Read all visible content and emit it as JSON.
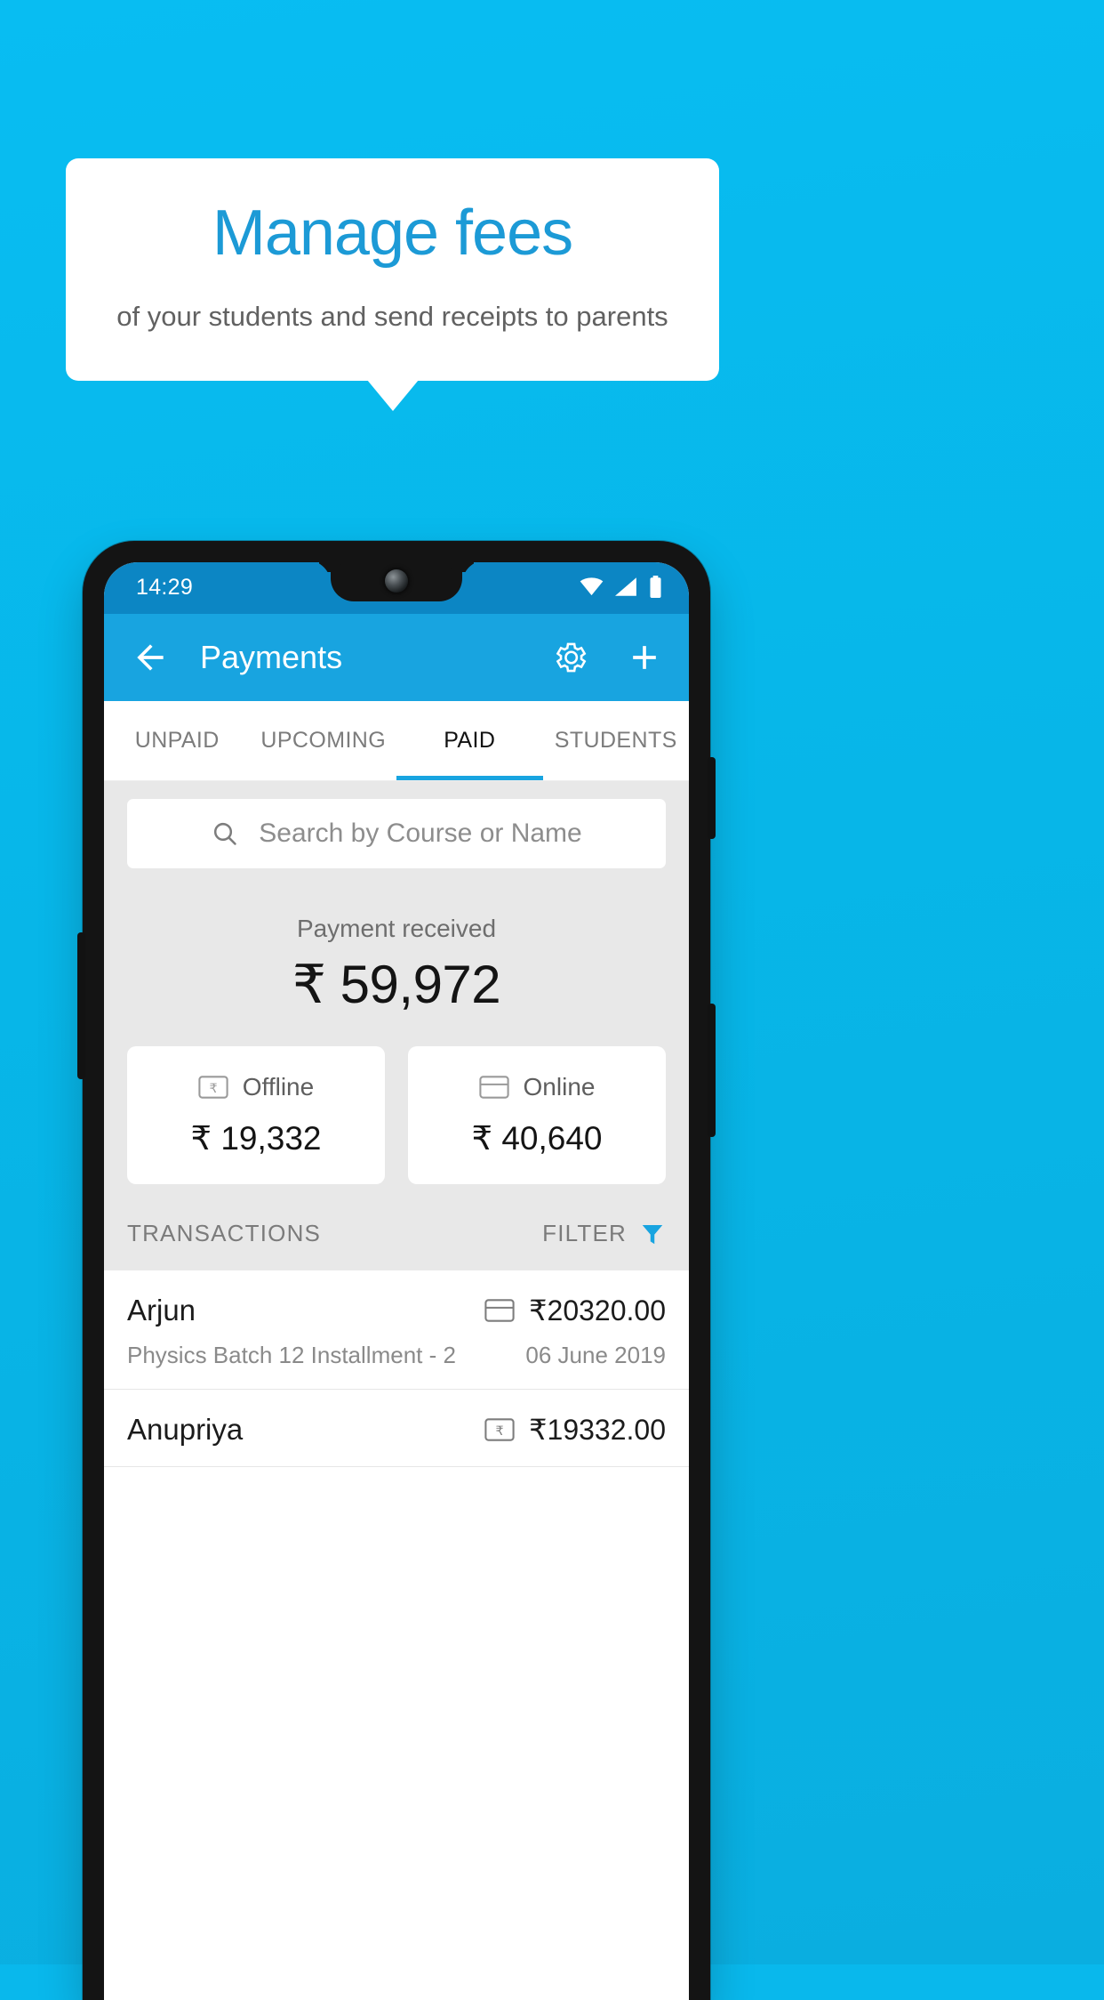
{
  "promo": {
    "headline": "Manage fees",
    "subheadline": "of your students and send receipts to parents",
    "background_color": "#09b8ec",
    "headline_color": "#1c9ad6",
    "card_color": "#ffffff"
  },
  "phone": {
    "status_bar": {
      "time": "14:29",
      "icons": [
        "wifi-icon",
        "signal-icon",
        "battery-icon"
      ],
      "background_color": "#0c86c4"
    },
    "app_bar": {
      "back_icon": "arrow-left-icon",
      "title": "Payments",
      "actions": [
        "gear-icon",
        "plus-icon"
      ],
      "background_color": "#18a4e0"
    },
    "tabs": {
      "items": [
        {
          "label": "UNPAID",
          "active": false
        },
        {
          "label": "UPCOMING",
          "active": false
        },
        {
          "label": "PAID",
          "active": true
        },
        {
          "label": "STUDENTS",
          "active": false
        }
      ],
      "indicator_color": "#18a4e0"
    },
    "search": {
      "icon": "search-icon",
      "placeholder": "Search by Course or Name",
      "value": ""
    },
    "summary": {
      "label": "Payment received",
      "amount": "₹ 59,972",
      "breakdown": [
        {
          "icon": "banknote-rupee-icon",
          "label": "Offline",
          "amount": "₹ 19,332"
        },
        {
          "icon": "credit-card-icon",
          "label": "Online",
          "amount": "₹ 40,640"
        }
      ]
    },
    "transactions_section": {
      "title": "TRANSACTIONS",
      "filter_label": "FILTER",
      "filter_icon": "funnel-icon",
      "filter_color": "#18a4e0",
      "rows": [
        {
          "name": "Arjun",
          "course": "Physics Batch 12 Installment - 2",
          "method_icon": "credit-card-icon",
          "amount": "₹20320.00",
          "date": "06 June 2019"
        },
        {
          "name": "Anupriya",
          "course": "",
          "method_icon": "banknote-rupee-icon",
          "amount": "₹19332.00",
          "date": ""
        }
      ]
    }
  }
}
